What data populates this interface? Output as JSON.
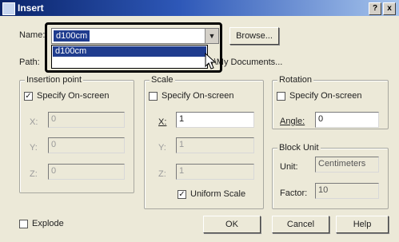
{
  "window": {
    "title": "Insert",
    "help": "?",
    "close": "x"
  },
  "name": {
    "label": "Name:",
    "value": "d100cm",
    "options": [
      "d100cm"
    ]
  },
  "browse_label": "Browse...",
  "path": {
    "label": "Path:",
    "value": "C:\\Documents and Settings\\Administrator\\My Documents..."
  },
  "insertion": {
    "legend": "Insertion point",
    "specify": "Specify On-screen",
    "x_label": "X:",
    "y_label": "Y:",
    "z_label": "Z:",
    "x": "0",
    "y": "0",
    "z": "0"
  },
  "scale": {
    "legend": "Scale",
    "specify": "Specify On-screen",
    "x_label": "X:",
    "y_label": "Y:",
    "z_label": "Z:",
    "x": "1",
    "y": "1",
    "z": "1",
    "uniform": "Uniform Scale"
  },
  "rotation": {
    "legend": "Rotation",
    "specify": "Specify On-screen",
    "angle_label": "Angle:",
    "angle": "0"
  },
  "block_unit": {
    "legend": "Block Unit",
    "unit_label": "Unit:",
    "unit": "Centimeters",
    "factor_label": "Factor:",
    "factor": "10"
  },
  "explode": "Explode",
  "buttons": {
    "ok": "OK",
    "cancel": "Cancel",
    "help": "Help"
  }
}
